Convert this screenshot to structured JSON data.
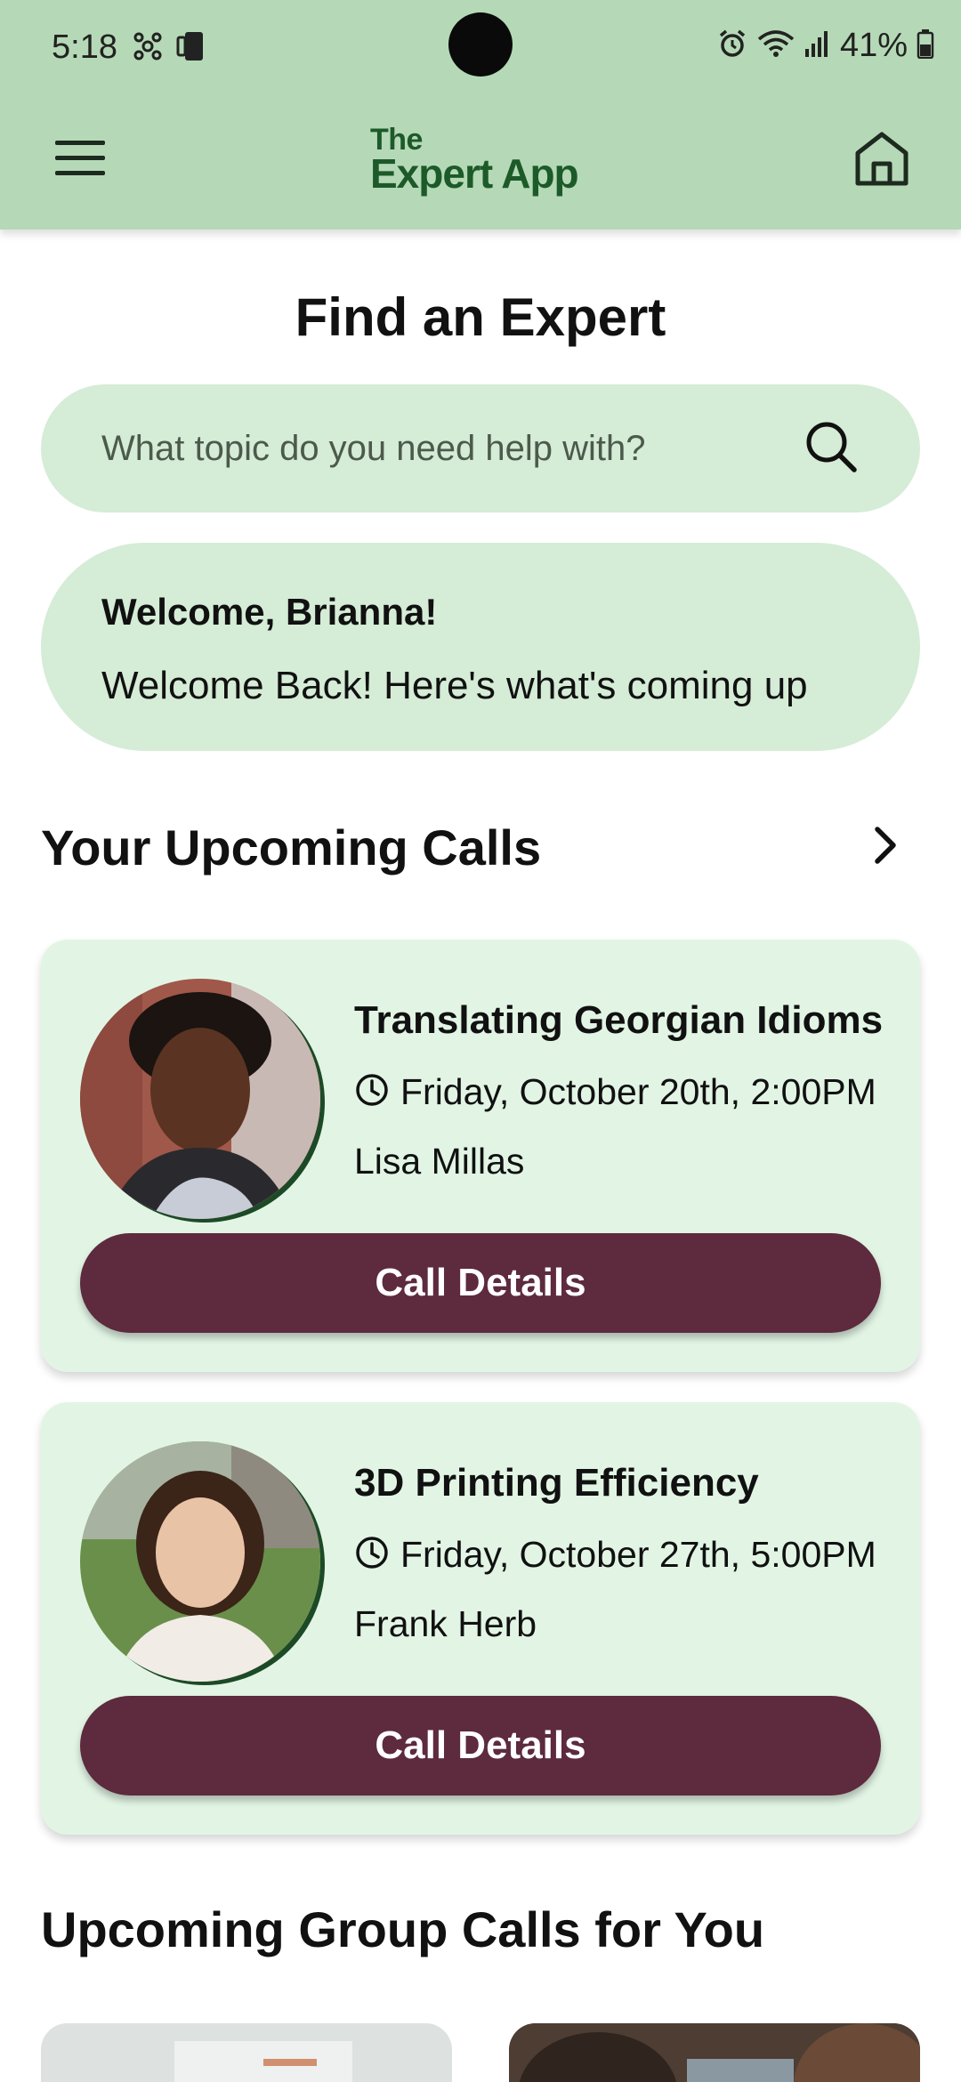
{
  "status_bar": {
    "time": "5:18",
    "battery": "41%",
    "icons": [
      "hub-icon",
      "phone-sync-icon",
      "alarm-icon",
      "wifi-icon",
      "signal-icon",
      "battery-icon"
    ]
  },
  "app_bar": {
    "logo_line1": "The",
    "logo_line2": "Expert App",
    "menu_icon": "hamburger-menu-icon",
    "home_icon": "home-icon"
  },
  "page": {
    "title": "Find an Expert"
  },
  "search": {
    "placeholder": "What topic do you need help with?",
    "value": "",
    "icon": "search-icon"
  },
  "welcome": {
    "title": "Welcome, Brianna!",
    "subtitle": "Welcome Back! Here's what's coming up"
  },
  "upcoming_calls": {
    "heading": "Your Upcoming Calls",
    "more_icon": "chevron-right-icon",
    "calls": [
      {
        "title": "Translating Georgian Idioms",
        "datetime": "Friday, October 20th, 2:00PM",
        "expert": "Lisa Millas",
        "button_label": "Call Details"
      },
      {
        "title": "3D Printing Efficiency",
        "datetime": "Friday, October 27th, 5:00PM",
        "expert": "Frank Herb",
        "button_label": "Call Details"
      }
    ]
  },
  "group_calls": {
    "heading": "Upcoming Group Calls for You"
  },
  "colors": {
    "app_bar": "#b5d9b6",
    "logo": "#1d5a2a",
    "pill_background": "#d5ecd6",
    "card_background": "#e2f5e5",
    "button": "#5d2a3e"
  }
}
